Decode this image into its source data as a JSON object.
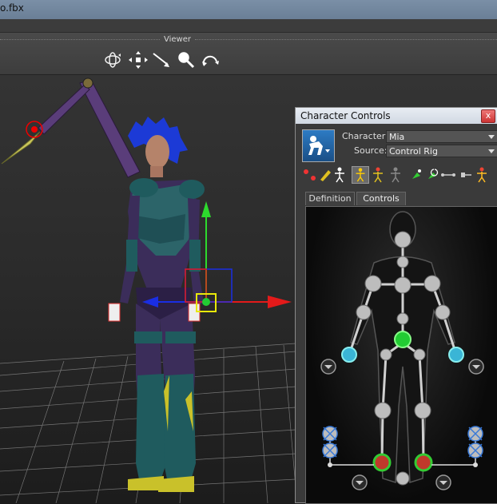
{
  "window": {
    "title": "o.fbx"
  },
  "viewer": {
    "label": "Viewer",
    "tools": [
      "orbit-tool-icon",
      "move-tool-icon",
      "pan-tool-icon",
      "zoom-tool-icon",
      "rotate-tool-icon"
    ]
  },
  "panel": {
    "title": "Character Controls",
    "close_label": "x",
    "character_label": "Character:",
    "character_value": "Mia",
    "source_label": "Source:",
    "source_value": "Control Rig",
    "tabs": [
      {
        "label": "Definition",
        "active": false
      },
      {
        "label": "Controls",
        "active": true
      }
    ],
    "colors": {
      "effector_selected": "#22cc33",
      "effector_highlight": "#3ab5d6",
      "effector_default": "#bdbdbd",
      "foot_effector": "#c0392b",
      "accent": "#2d7bc4"
    }
  },
  "scene": {
    "axis_colors": {
      "x": "#e31a1a",
      "y": "#2ddb2d",
      "z": "#1a2ee3"
    }
  }
}
